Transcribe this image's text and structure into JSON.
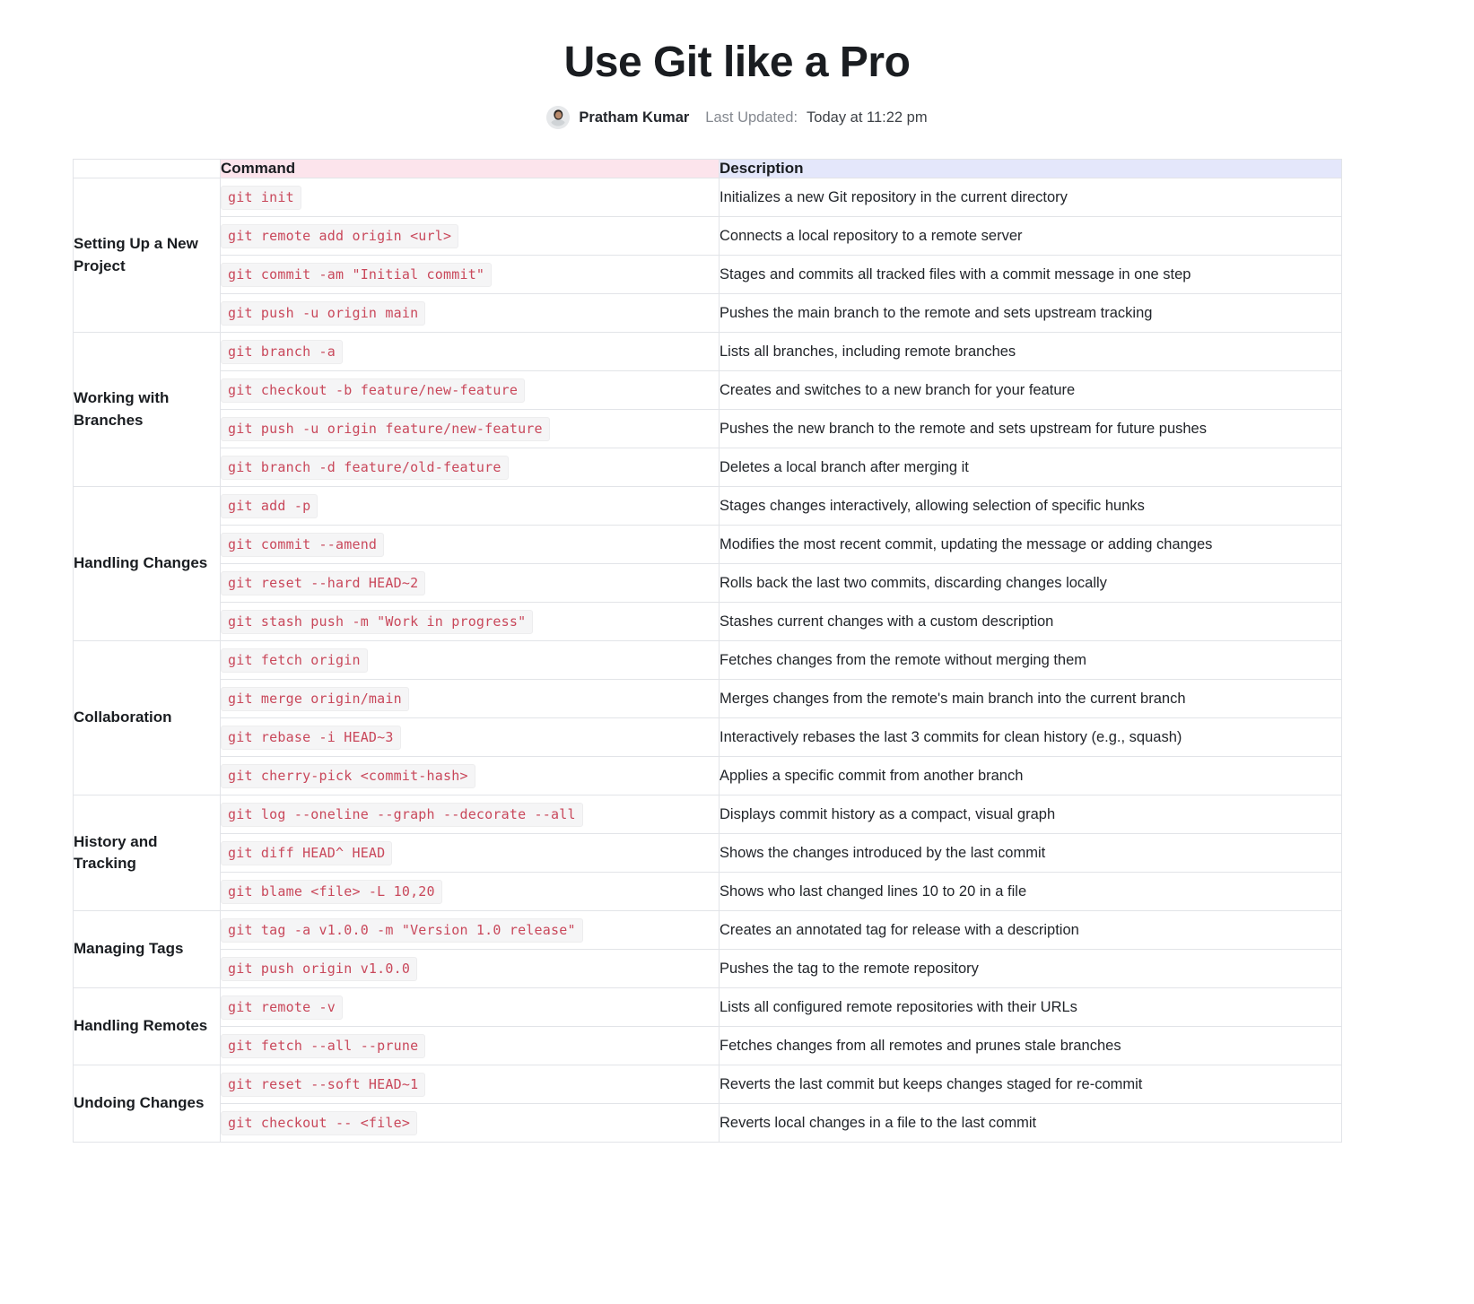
{
  "header": {
    "title": "Use Git like a Pro",
    "author": "Pratham Kumar",
    "updated_label": "Last Updated:",
    "updated_value": "Today at 11:22 pm",
    "avatar_name": "user-avatar"
  },
  "colors": {
    "command_header_bg": "#fce4ec",
    "description_header_bg": "#e4e7fb",
    "code_text": "#c9485b",
    "code_bg": "#f5f5f6",
    "border": "#e2e4e8"
  },
  "table": {
    "columns": {
      "group": "",
      "command": "Command",
      "description": "Description"
    },
    "groups": [
      {
        "label": "Setting Up a New Project",
        "rows": [
          {
            "command": "git init",
            "description": "Initializes a new Git repository in the current directory"
          },
          {
            "command": "git remote add origin <url>",
            "description": "Connects a local repository to a remote server"
          },
          {
            "command": "git commit -am \"Initial commit\"",
            "description": "Stages and commits all tracked files with a commit message in one step"
          },
          {
            "command": "git push -u origin main",
            "description": "Pushes the main branch to the remote and sets upstream tracking"
          }
        ]
      },
      {
        "label": "Working with Branches",
        "rows": [
          {
            "command": "git branch -a",
            "description": "Lists all branches, including remote branches"
          },
          {
            "command": "git checkout -b feature/new-feature",
            "description": "Creates and switches to a new branch for your feature"
          },
          {
            "command": "git push -u origin feature/new-feature",
            "description": "Pushes the new branch to the remote and sets upstream for future pushes"
          },
          {
            "command": "git branch -d feature/old-feature",
            "description": "Deletes a local branch after merging it"
          }
        ]
      },
      {
        "label": "Handling Changes",
        "rows": [
          {
            "command": "git add -p",
            "description": "Stages changes interactively, allowing selection of specific hunks"
          },
          {
            "command": "git commit --amend",
            "description": "Modifies the most recent commit, updating the message or adding changes"
          },
          {
            "command": "git reset --hard HEAD~2",
            "description": "Rolls back the last two commits, discarding changes locally"
          },
          {
            "command": "git stash push -m \"Work in progress\"",
            "description": "Stashes current changes with a custom description"
          }
        ]
      },
      {
        "label": "Collaboration",
        "rows": [
          {
            "command": "git fetch origin",
            "description": "Fetches changes from the remote without merging them"
          },
          {
            "command": "git merge origin/main",
            "description": "Merges changes from the remote's main branch into the current branch"
          },
          {
            "command": "git rebase -i HEAD~3",
            "description": "Interactively rebases the last 3 commits for clean history (e.g., squash)"
          },
          {
            "command": "git cherry-pick <commit-hash>",
            "description": "Applies a specific commit from another branch"
          }
        ]
      },
      {
        "label": "History and Tracking",
        "rows": [
          {
            "command": "git log --oneline --graph --decorate --all",
            "description": "Displays commit history as a compact, visual graph"
          },
          {
            "command": "git diff HEAD^ HEAD",
            "description": "Shows the changes introduced by the last commit"
          },
          {
            "command": "git blame <file> -L 10,20",
            "description": "Shows who last changed lines 10 to 20 in a file"
          }
        ]
      },
      {
        "label": "Managing Tags",
        "rows": [
          {
            "command": "git tag -a v1.0.0 -m \"Version 1.0 release\"",
            "description": "Creates an annotated tag for release with a description"
          },
          {
            "command": "git push origin v1.0.0",
            "description": "Pushes the tag to the remote repository"
          }
        ]
      },
      {
        "label": "Handling Remotes",
        "rows": [
          {
            "command": "git remote -v",
            "description": "Lists all configured remote repositories with their URLs"
          },
          {
            "command": "git fetch --all --prune",
            "description": "Fetches changes from all remotes and prunes stale branches"
          }
        ]
      },
      {
        "label": "Undoing Changes",
        "rows": [
          {
            "command": "git reset --soft HEAD~1",
            "description": "Reverts the last commit but keeps changes staged for re-commit"
          },
          {
            "command": "git checkout -- <file>",
            "description": "Reverts local changes in a file to the last commit"
          }
        ]
      }
    ]
  }
}
